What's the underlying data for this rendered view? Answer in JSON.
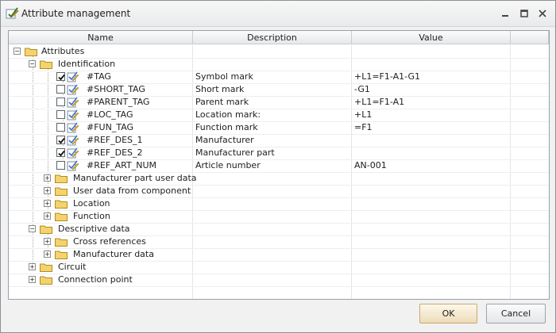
{
  "window": {
    "title": "Attribute management"
  },
  "columns": {
    "name": "Name",
    "description": "Description",
    "value": "Value"
  },
  "tree": {
    "attributes": "Attributes",
    "identification": "Identification",
    "items": [
      {
        "name": "#TAG",
        "description": "Symbol mark",
        "value": "+L1=F1-A1-G1",
        "checked": true
      },
      {
        "name": "#SHORT_TAG",
        "description": "Short mark",
        "value": "-G1",
        "checked": false
      },
      {
        "name": "#PARENT_TAG",
        "description": "Parent mark",
        "value": "+L1=F1-A1",
        "checked": false
      },
      {
        "name": "#LOC_TAG",
        "description": "Location mark:",
        "value": "+L1",
        "checked": false
      },
      {
        "name": "#FUN_TAG",
        "description": "Function mark",
        "value": "=F1",
        "checked": false
      },
      {
        "name": "#REF_DES_1",
        "description": "Manufacturer",
        "value": "",
        "checked": true
      },
      {
        "name": "#REF_DES_2",
        "description": "Manufacturer part",
        "value": "",
        "checked": true
      },
      {
        "name": "#REF_ART_NUM",
        "description": "Article number",
        "value": "AN-001",
        "checked": false
      }
    ],
    "identification_groups": [
      "Manufacturer part user data",
      "User data from component",
      "Location",
      "Function"
    ],
    "descriptive_data": "Descriptive data",
    "descriptive_groups": [
      "Cross references",
      "Manufacturer data"
    ],
    "top_groups": [
      "Circuit",
      "Connection point"
    ]
  },
  "buttons": {
    "ok": "OK",
    "cancel": "Cancel"
  },
  "icons": {
    "app": "attribute-edit-icon",
    "folder": "folder-icon",
    "attribute": "attribute-pencil-icon",
    "minimize": "minimize-icon",
    "maximize": "maximize-icon",
    "close": "close-icon"
  },
  "colors": {
    "folder": "#f3d36d",
    "accent": "#3a76c9"
  }
}
